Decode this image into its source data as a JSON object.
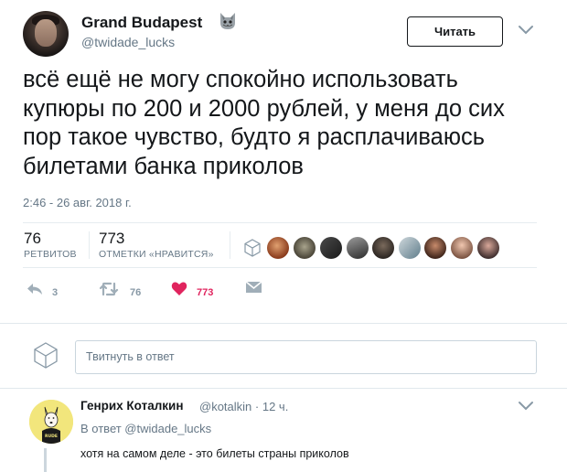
{
  "tweet": {
    "author_name": "Grand Budapest",
    "author_emoji_icon": "cat-face-icon",
    "author_handle": "@twidade_lucks",
    "follow_label": "Читать",
    "text": "всё ещё не могу спокойно использовать купюры по 200 и 2000 рублей, у меня до сих пор такое чувство, будто я расплачиваюсь билетами банка приколов",
    "timestamp": "2:46 - 26 авг. 2018 г.",
    "stats": {
      "retweets_count": "76",
      "retweets_label": "РЕТВИТОВ",
      "likes_count": "773",
      "likes_label": "ОТМЕТКИ «НРАВИТСЯ»"
    },
    "actions": {
      "reply_count": "3",
      "retweet_count": "76",
      "like_count": "773"
    }
  },
  "colors": {
    "like_red": "#e0245e",
    "muted": "#657786",
    "divider": "#e6ecf0"
  },
  "reply_composer": {
    "placeholder": "Твитнуть в ответ"
  },
  "reply": {
    "author_name": "Генрих Коталкин",
    "author_handle": "@kotalkin",
    "time": "· 12 ч.",
    "in_reply_to": "В ответ @twidade_lucks",
    "text": "хотя на самом деле - это билеты страны приколов",
    "avatar_text": "RUDE"
  }
}
